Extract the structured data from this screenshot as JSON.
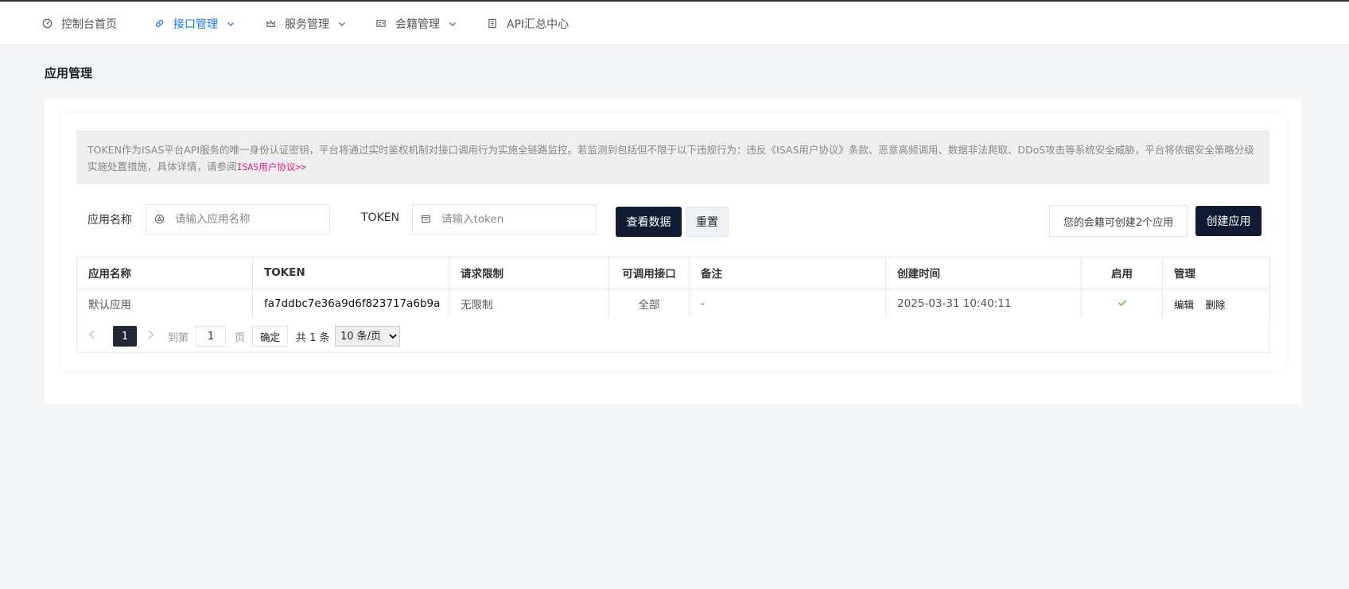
{
  "nav": {
    "items": [
      {
        "label": "控制台首页",
        "icon": "dashboard-icon",
        "active": false,
        "dropdown": false
      },
      {
        "label": "接口管理",
        "icon": "link-icon",
        "active": true,
        "dropdown": true
      },
      {
        "label": "服务管理",
        "icon": "crown-icon",
        "active": false,
        "dropdown": true
      },
      {
        "label": "会籍管理",
        "icon": "id-card-icon",
        "active": false,
        "dropdown": true
      },
      {
        "label": "API汇总中心",
        "icon": "building-icon",
        "active": false,
        "dropdown": false
      }
    ],
    "active_color": "#1677ff"
  },
  "page": {
    "title": "应用管理"
  },
  "notice": {
    "text": "TOKEN作为ISAS平台API服务的唯一身份认证密钥，平台将通过实时鉴权机制对接口调用行为实施全链路监控。若监测到包括但不限于以下违规行为：违反《ISAS用户协议》条款、恶意高频调用、数据非法爬取、DDoS攻击等系统安全威胁，平台将依据安全策略分级实施处置措施，具体详情，请参阅",
    "link": "ISAS用户协议>>"
  },
  "filters": {
    "app_name_label": "应用名称",
    "app_name_placeholder": "请输入应用名称",
    "app_name_value": "",
    "token_label": "TOKEN",
    "token_placeholder": "请输入token",
    "token_value": ""
  },
  "buttons": {
    "query": "查看数据",
    "reset": "重置",
    "create": "创建应用"
  },
  "quota_text": "您的会籍可创建2个应用",
  "table": {
    "columns": [
      "应用名称",
      "TOKEN",
      "请求限制",
      "可调用接口",
      "备注",
      "创建时间",
      "启用",
      "管理"
    ],
    "rows": [
      {
        "name": "默认应用",
        "token": "fa7ddbc7e36a9d6f823717a6b9a",
        "limit": "无限制",
        "apis": "全部",
        "remark": "-",
        "created": "2025-03-31 10:40:11",
        "enabled": true,
        "actions": [
          "编辑",
          "删除"
        ]
      }
    ]
  },
  "pagination": {
    "current_page": "1",
    "goto_label": "到第",
    "goto_value": "1",
    "page_suffix": "页",
    "confirm": "确定",
    "total": "共 1 条",
    "page_size": "10 条/页",
    "page_size_options": [
      "10 条/页"
    ]
  },
  "colors": {
    "dark_button": "#111a33",
    "enabled_check": "#52c41a",
    "notice_link": "#e0218a"
  }
}
